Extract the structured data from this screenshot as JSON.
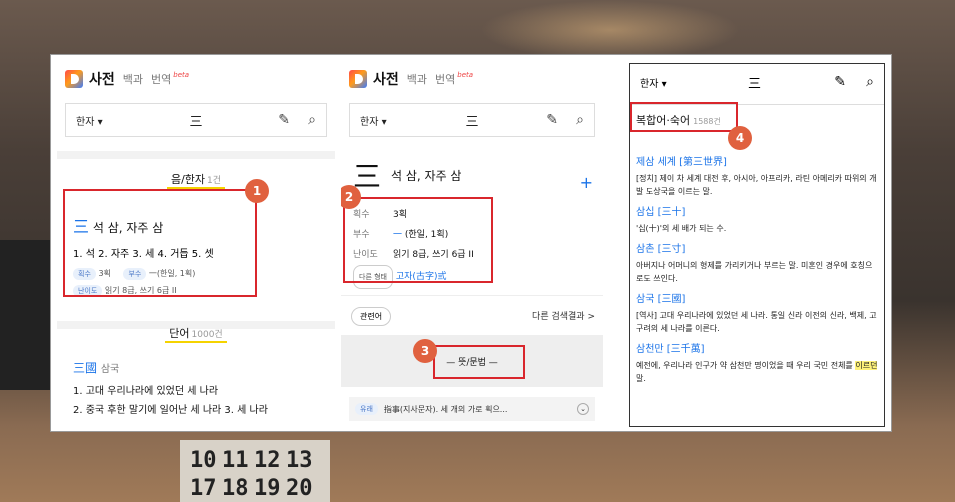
{
  "logo": {
    "title": "사전",
    "tab1": "백과",
    "tab2": "번역",
    "beta": "beta"
  },
  "search": {
    "type": "한자",
    "query": "三"
  },
  "panel1": {
    "section1_title": "음/한자",
    "section1_count": "1건",
    "entry_char": "三",
    "entry_reading": "석 삼, 자주 삼",
    "meanings": "1. 석  2. 자주  3. 세  4. 거듭  5. 셋",
    "tag_strokes": "획수",
    "strokes": "3획",
    "tag_radical": "부수",
    "radical": "一(한일, 1획)",
    "tag_level": "난이도",
    "level": "읽기 8급, 쓰기 6급 II",
    "section2_title": "단어",
    "section2_count": "1000건",
    "word_han": "三國",
    "word_reading": "삼국",
    "word_def": "1. 고대 우리나라에 있었던 세 나라",
    "word_def2": "2. 중국 후한 말기에 일어난 세 나라   3. 세 나라"
  },
  "panel2": {
    "char": "三",
    "reading": "석 삼, 자주 삼",
    "lbl_strokes": "획수",
    "strokes": "3획",
    "lbl_radical": "부수",
    "radical_char": "一",
    "radical_desc": "(한일, 1획)",
    "lbl_level": "난이도",
    "level": "읽기 8급, 쓰기 6급 II",
    "lbl_other": "다른 형태",
    "other_form": "고자(古字)弎",
    "related_btn": "관련어",
    "more_results": "다른 검색결과 >",
    "meaning_title": "뜻/문법",
    "accordion_tag": "유래",
    "accordion_text": "指事(지사문자). 세 개의 가로 획으..."
  },
  "panel3": {
    "section_title": "복합어·숙어",
    "section_count": "1588건",
    "items": [
      {
        "head": "제삼 세계 [第三世界]",
        "def": "[정치] 제이 차 세계 대전 후, 아시아, 아프리카, 라틴 아메리카 따위의 개발 도상국을 이르는 말."
      },
      {
        "head": "삼십 [三十]",
        "def": "'십(十)'의 세 배가 되는 수."
      },
      {
        "head": "삼촌 [三寸]",
        "def": "아버지나 어머니의 형제를 가리키거나 부르는 말. 미혼인 경우에 호칭으로도 쓰인다."
      },
      {
        "head": "삼국 [三國]",
        "def": "[역사] 고대 우리나라에 있었던 세 나라. 통일 신라 이전의 신라, 백제, 고구려의 세 나라를 이른다."
      },
      {
        "head": "삼천만 [三千萬]",
        "def": "예전에, 우리나라 인구가 약 삼천만 명이었을 때 우리 국민 전체를 ",
        "highlight": "이르던",
        "tail": " 말."
      }
    ]
  },
  "badges": [
    "1",
    "2",
    "3",
    "4"
  ],
  "colors": {
    "accent_red": "#d9262c",
    "badge_orange": "#e0613f",
    "link_blue": "#1a73e8",
    "highlight_yellow": "#f5d300"
  }
}
